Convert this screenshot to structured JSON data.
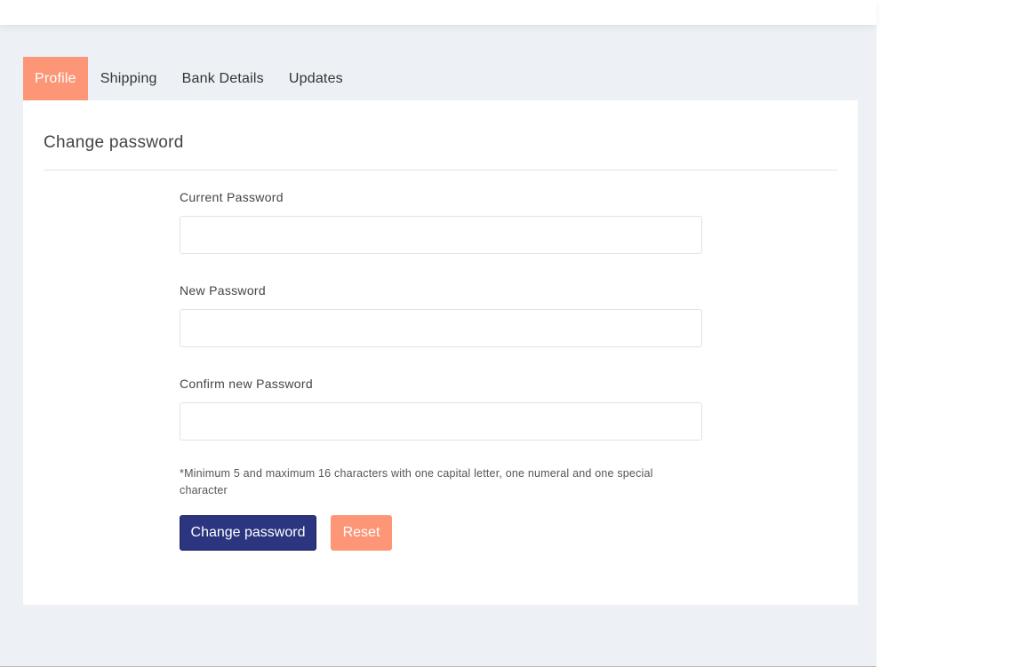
{
  "tabs": [
    {
      "label": "Profile",
      "active": true
    },
    {
      "label": "Shipping",
      "active": false
    },
    {
      "label": "Bank Details",
      "active": false
    },
    {
      "label": "Updates",
      "active": false
    }
  ],
  "card": {
    "title": "Change password"
  },
  "form": {
    "current_password": {
      "label": "Current Password",
      "value": ""
    },
    "new_password": {
      "label": "New Password",
      "value": ""
    },
    "confirm_password": {
      "label": "Confirm new Password",
      "value": ""
    },
    "hint": "*Minimum 5 and maximum 16 characters with one capital letter, one numeral and one special character",
    "submit_label": "Change password",
    "reset_label": "Reset"
  },
  "colors": {
    "accent": "#fc9676",
    "primary": "#2b3580",
    "background": "#edf0f5"
  }
}
